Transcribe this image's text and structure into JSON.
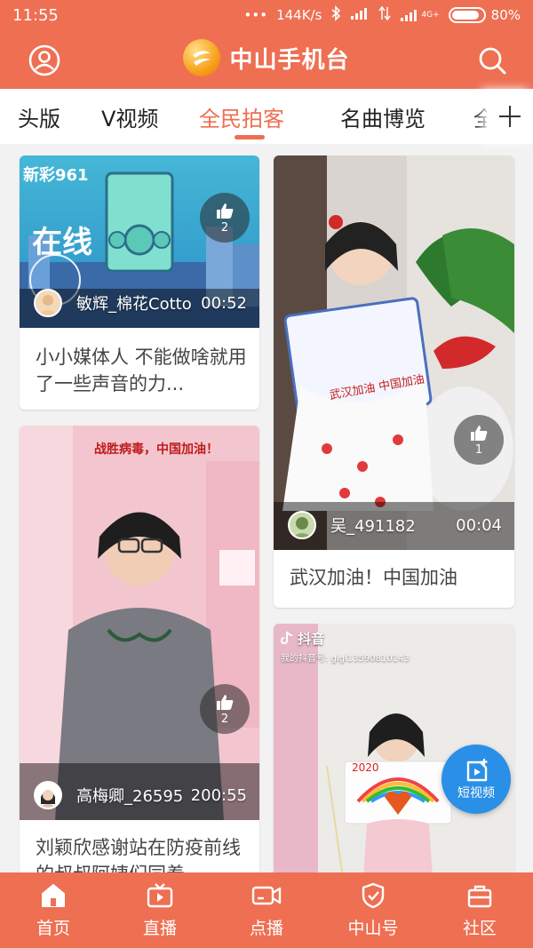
{
  "status": {
    "time": "11:55",
    "dots": "•••",
    "speed": "144K/s",
    "network_label": "4G+",
    "battery": "80%"
  },
  "app": {
    "title": "中山手机台"
  },
  "tabs": [
    {
      "label": "头版",
      "active": false
    },
    {
      "label": "V视频",
      "active": false
    },
    {
      "label": "全民拍客",
      "active": true
    },
    {
      "label": "名曲博览",
      "active": false
    },
    {
      "label": "全",
      "active": false
    }
  ],
  "cards": [
    {
      "user": "敏辉_棉花Cotto",
      "duration": "00:52",
      "likes": "2",
      "caption": "小小媒体人 不能做啥就用了一些声音的力...",
      "overlay_brand": "新彩961",
      "overlay_text": "在线"
    },
    {
      "user": "吴_491182",
      "duration": "00:04",
      "likes": "1",
      "caption": "武汉加油！中国加油",
      "poster_text": "武汉加油 中国加油"
    },
    {
      "user": "高梅卿_26595",
      "duration": "200:55",
      "likes": "2",
      "caption": "刘颖欣感谢站在防疫前线的叔叔阿姨们同着",
      "banner": "战胜病毒，中国加油！"
    },
    {
      "watermark_app": "抖音",
      "watermark_id": "我的抖音号: gigi13590810143",
      "poster_year": "2020"
    }
  ],
  "fab": {
    "label": "短视频"
  },
  "nav": [
    {
      "label": "首页",
      "icon": "home-icon"
    },
    {
      "label": "直播",
      "icon": "tv-icon"
    },
    {
      "label": "点播",
      "icon": "video-camera-icon"
    },
    {
      "label": "中山号",
      "icon": "shield-check-icon"
    },
    {
      "label": "社区",
      "icon": "bag-icon"
    }
  ],
  "colors": {
    "brand": "#ee6f52",
    "fab": "#2a8fe6"
  }
}
